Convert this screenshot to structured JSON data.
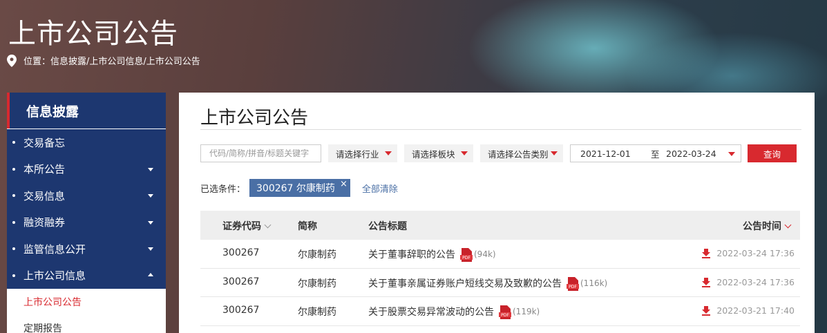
{
  "banner": {
    "title": "上市公司公告",
    "breadcrumb": "位置：信息披露/上市公司信息/上市公司公告"
  },
  "sidebar": {
    "heading": "信息披露",
    "items": [
      {
        "label": "交易备忘",
        "caret": "none"
      },
      {
        "label": "本所公告",
        "caret": "down"
      },
      {
        "label": "交易信息",
        "caret": "down"
      },
      {
        "label": "融资融券",
        "caret": "down"
      },
      {
        "label": "监管信息公开",
        "caret": "down"
      },
      {
        "label": "上市公司信息",
        "caret": "up"
      }
    ],
    "sub_items": [
      {
        "label": "上市公司公告",
        "active": true
      },
      {
        "label": "定期报告",
        "active": false
      }
    ]
  },
  "main": {
    "title": "上市公司公告",
    "filters": {
      "keyword_placeholder": "代码/简称/拼音/标题关键字",
      "industry": "请选择行业",
      "board": "请选择板块",
      "category": "请选择公告类别",
      "date_from": "2021-12-01",
      "date_to_sep": "至",
      "date_to": "2022-03-24",
      "query": "查询"
    },
    "chosen": {
      "label": "已选条件：",
      "tag": "300267 尔康制药",
      "clear": "全部清除"
    },
    "table": {
      "headers": {
        "code": "证券代码",
        "name": "简称",
        "title": "公告标题",
        "time": "公告时间"
      },
      "rows": [
        {
          "code": "300267",
          "name": "尔康制药",
          "title": "关于董事辞职的公告",
          "size": "(94k)",
          "time": "2022-03-24 17:36"
        },
        {
          "code": "300267",
          "name": "尔康制药",
          "title": "关于董事亲属证券账户短线交易及致歉的公告",
          "size": "(116k)",
          "time": "2022-03-24 17:36"
        },
        {
          "code": "300267",
          "name": "尔康制药",
          "title": "关于股票交易异常波动的公告",
          "size": "(119k)",
          "time": "2022-03-21 17:40"
        }
      ]
    }
  },
  "colors": {
    "accent": "#d8292f",
    "nav": "#1d3770",
    "tag": "#4a6fa5"
  }
}
